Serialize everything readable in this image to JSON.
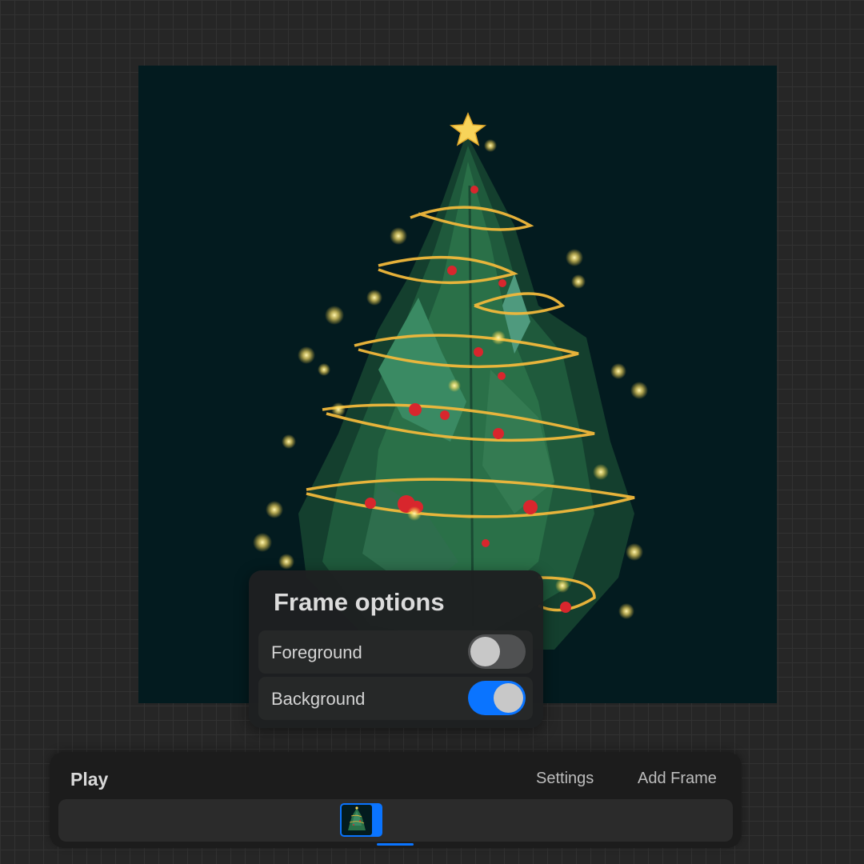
{
  "frame_options": {
    "title": "Frame options",
    "foreground": {
      "label": "Foreground",
      "enabled": false
    },
    "background": {
      "label": "Background",
      "enabled": true
    }
  },
  "timeline": {
    "play_label": "Play",
    "settings_label": "Settings",
    "add_frame_label": "Add Frame",
    "frame_count": 1,
    "selected_frame": 1
  },
  "colors": {
    "accent": "#0a74ff",
    "canvas_background": "#031b1f",
    "garland": "#f2b93b",
    "berry": "#d8262d"
  },
  "canvas": {
    "artwork": "christmas-tree-illustration"
  }
}
